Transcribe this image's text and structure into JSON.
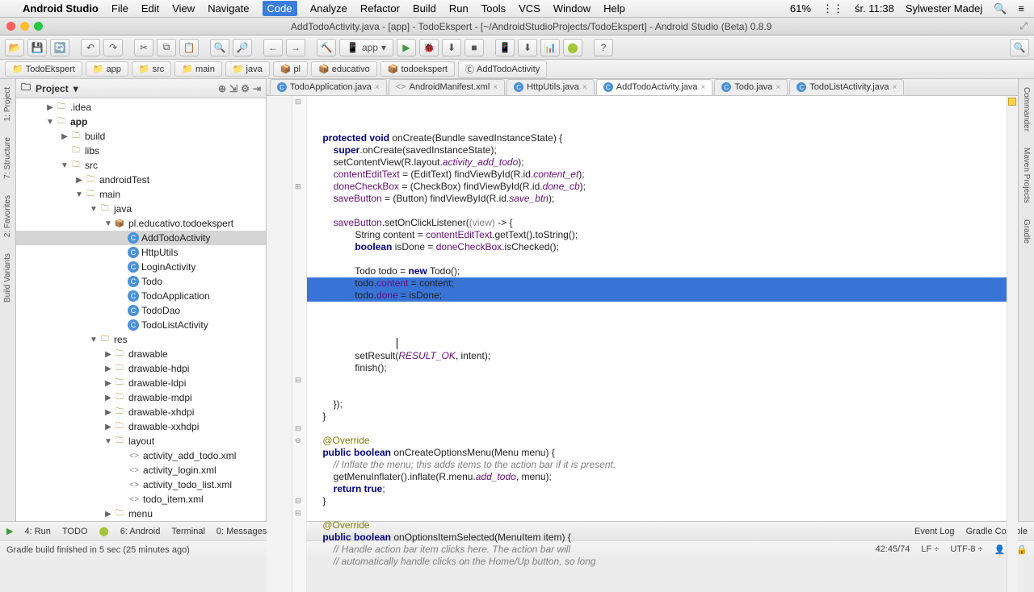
{
  "menubar": {
    "app": "Android Studio",
    "items": [
      "File",
      "Edit",
      "View",
      "Navigate",
      "Code",
      "Analyze",
      "Refactor",
      "Build",
      "Run",
      "Tools",
      "VCS",
      "Window",
      "Help"
    ],
    "active_index": 4,
    "battery": "61%",
    "date": "śr. 11:38",
    "user": "Sylwester Madej"
  },
  "titlebar": {
    "title": "AddTodoActivity.java - [app] - TodoEkspert - [~/AndroidStudioProjects/TodoEkspert] - Android Studio (Beta) 0.8.9"
  },
  "toolbar": {
    "run_config": "app"
  },
  "breadcrumb": {
    "items": [
      "TodoEkspert",
      "app",
      "src",
      "main",
      "java",
      "pl",
      "educativo",
      "todoekspert",
      "AddTodoActivity"
    ]
  },
  "project": {
    "header": "Project",
    "tree": [
      {
        "d": 2,
        "exp": "▶",
        "ico": "folder",
        "label": ".idea"
      },
      {
        "d": 2,
        "exp": "▼",
        "ico": "folder",
        "label": "app",
        "bold": true
      },
      {
        "d": 3,
        "exp": "▶",
        "ico": "folder",
        "label": "build"
      },
      {
        "d": 3,
        "exp": "",
        "ico": "folder",
        "label": "libs"
      },
      {
        "d": 3,
        "exp": "▼",
        "ico": "folder",
        "label": "src"
      },
      {
        "d": 4,
        "exp": "▶",
        "ico": "folder",
        "label": "androidTest"
      },
      {
        "d": 4,
        "exp": "▼",
        "ico": "folder",
        "label": "main"
      },
      {
        "d": 5,
        "exp": "▼",
        "ico": "folder",
        "label": "java"
      },
      {
        "d": 6,
        "exp": "▼",
        "ico": "pkg",
        "label": "pl.educativo.todoekspert"
      },
      {
        "d": 7,
        "exp": "",
        "ico": "jclass",
        "label": "AddTodoActivity",
        "sel": true
      },
      {
        "d": 7,
        "exp": "",
        "ico": "jclass",
        "label": "HttpUtils"
      },
      {
        "d": 7,
        "exp": "",
        "ico": "jclass",
        "label": "LoginActivity"
      },
      {
        "d": 7,
        "exp": "",
        "ico": "jclass",
        "label": "Todo"
      },
      {
        "d": 7,
        "exp": "",
        "ico": "jclass",
        "label": "TodoApplication"
      },
      {
        "d": 7,
        "exp": "",
        "ico": "jclass",
        "label": "TodoDao"
      },
      {
        "d": 7,
        "exp": "",
        "ico": "jclass",
        "label": "TodoListActivity"
      },
      {
        "d": 5,
        "exp": "▼",
        "ico": "folder",
        "label": "res"
      },
      {
        "d": 6,
        "exp": "▶",
        "ico": "folder",
        "label": "drawable"
      },
      {
        "d": 6,
        "exp": "▶",
        "ico": "folder",
        "label": "drawable-hdpi"
      },
      {
        "d": 6,
        "exp": "▶",
        "ico": "folder",
        "label": "drawable-ldpi"
      },
      {
        "d": 6,
        "exp": "▶",
        "ico": "folder",
        "label": "drawable-mdpi"
      },
      {
        "d": 6,
        "exp": "▶",
        "ico": "folder",
        "label": "drawable-xhdpi"
      },
      {
        "d": 6,
        "exp": "▶",
        "ico": "folder",
        "label": "drawable-xxhdpi"
      },
      {
        "d": 6,
        "exp": "▼",
        "ico": "folder",
        "label": "layout"
      },
      {
        "d": 7,
        "exp": "",
        "ico": "xml",
        "label": "activity_add_todo.xml"
      },
      {
        "d": 7,
        "exp": "",
        "ico": "xml",
        "label": "activity_login.xml"
      },
      {
        "d": 7,
        "exp": "",
        "ico": "xml",
        "label": "activity_todo_list.xml"
      },
      {
        "d": 7,
        "exp": "",
        "ico": "xml",
        "label": "todo_item.xml"
      },
      {
        "d": 6,
        "exp": "▶",
        "ico": "folder",
        "label": "menu"
      }
    ]
  },
  "tabs": [
    {
      "ico": "j",
      "label": "TodoApplication.java",
      "active": false
    },
    {
      "ico": "x",
      "label": "AndroidManifest.xml",
      "active": false
    },
    {
      "ico": "j",
      "label": "HttpUtils.java",
      "active": false
    },
    {
      "ico": "j",
      "label": "AddTodoActivity.java",
      "active": true
    },
    {
      "ico": "j",
      "label": "Todo.java",
      "active": false
    },
    {
      "ico": "j",
      "label": "TodoListActivity.java",
      "active": false
    }
  ],
  "bottombar": {
    "items": [
      "4: Run",
      "TODO",
      "6: Android",
      "Terminal",
      "0: Messages"
    ],
    "right": [
      "Event Log",
      "Gradle Console"
    ]
  },
  "statusbar": {
    "msg": "Gradle build finished in 5 sec (25 minutes ago)",
    "pos": "42:45/74",
    "lf": "LF ÷",
    "enc": "UTF-8 ÷"
  },
  "leftstrips": [
    "1: Project",
    "7: Structure",
    "2: Favorites",
    "Build Variants"
  ],
  "rightstrips": [
    "Commander",
    "Maven Projects",
    "Gradle"
  ]
}
